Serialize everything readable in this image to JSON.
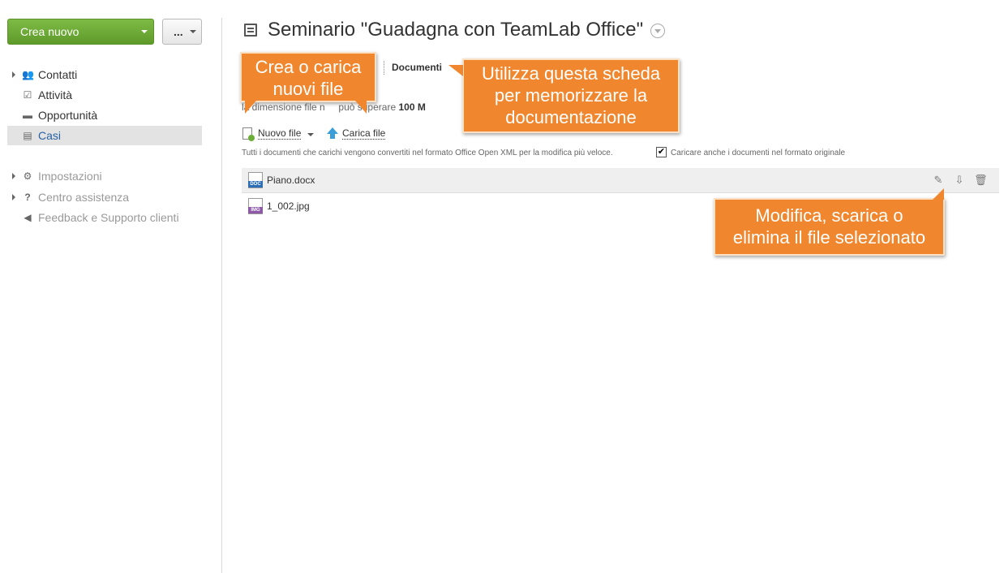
{
  "sidebar": {
    "create_label": "Crea nuovo",
    "more_label": "...",
    "items": [
      {
        "label": "Contatti"
      },
      {
        "label": "Attività"
      },
      {
        "label": "Opportunità"
      },
      {
        "label": "Casi"
      }
    ],
    "footer_items": [
      {
        "label": "Impostazioni"
      },
      {
        "label": "Centro assistenza"
      },
      {
        "label": "Feedback e Supporto clienti"
      }
    ]
  },
  "header": {
    "title": "Seminario \"Guadagna con TeamLab Office\""
  },
  "tabs": {
    "documents": "Documenti"
  },
  "size_note": {
    "prefix": "la dimensione file n",
    "middle": "può superare",
    "value": "100 M"
  },
  "actions": {
    "new_file": "Nuovo file",
    "upload": "Carica file"
  },
  "convert_note": "Tutti i documenti che carichi vengono convertiti nel formato Office Open XML per la modifica più veloce.",
  "keep_original_label": "Caricare anche i documenti nel formato originale",
  "keep_original_checked": "✔",
  "files": [
    {
      "name": "Piano.docx",
      "type_tag": "DOC",
      "tag_color": "#2d6fb7"
    },
    {
      "name": "1_002.jpg",
      "type_tag": "IMG",
      "tag_color": "#8e5aa8"
    }
  ],
  "callouts": {
    "create": "Crea o carica\nnuovi file",
    "tab": "Utilizza questa scheda\nper memorizzare la\ndocumentazione",
    "actions": "Modifica, scarica o\nelimina il file selezionato"
  },
  "colors": {
    "accent_green": "#6aa834",
    "callout_orange": "#f0862d",
    "link_blue": "#2861a4"
  }
}
